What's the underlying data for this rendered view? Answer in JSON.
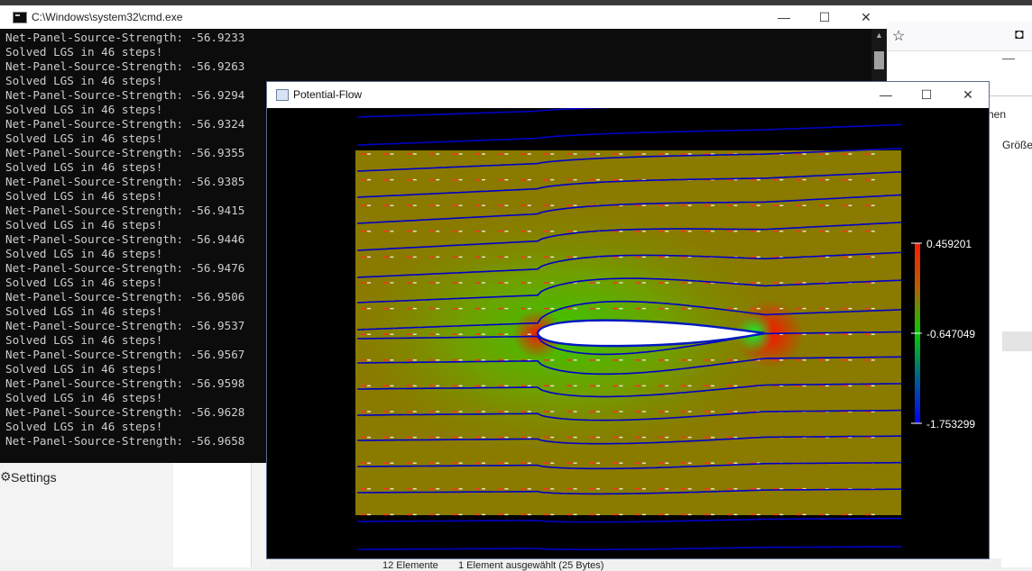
{
  "cmd": {
    "title": "C:\\Windows\\system32\\cmd.exe",
    "lines": [
      "Net-Panel-Source-Strength: -56.9233",
      "Solved LGS in 46 steps!",
      "Net-Panel-Source-Strength: -56.9263",
      "Solved LGS in 46 steps!",
      "Net-Panel-Source-Strength: -56.9294",
      "Solved LGS in 46 steps!",
      "Net-Panel-Source-Strength: -56.9324",
      "Solved LGS in 46 steps!",
      "Net-Panel-Source-Strength: -56.9355",
      "Solved LGS in 46 steps!",
      "Net-Panel-Source-Strength: -56.9385",
      "Solved LGS in 46 steps!",
      "Net-Panel-Source-Strength: -56.9415",
      "Solved LGS in 46 steps!",
      "Net-Panel-Source-Strength: -56.9446",
      "Solved LGS in 46 steps!",
      "Net-Panel-Source-Strength: -56.9476",
      "Solved LGS in 46 steps!",
      "Net-Panel-Source-Strength: -56.9506",
      "Solved LGS in 46 steps!",
      "Net-Panel-Source-Strength: -56.9537",
      "Solved LGS in 46 steps!",
      "Net-Panel-Source-Strength: -56.9567",
      "Solved LGS in 46 steps!",
      "Net-Panel-Source-Strength: -56.9598",
      "Solved LGS in 46 steps!",
      "Net-Panel-Source-Strength: -56.9628",
      "Solved LGS in 46 steps!",
      "Net-Panel-Source-Strength: -56.9658"
    ],
    "minimize_icon": "minimize-icon",
    "maximize_icon": "maximize-icon",
    "close_icon": "close-icon"
  },
  "potential_flow": {
    "title": "Potential-Flow",
    "colorbar": {
      "max_label": "0.459201",
      "mid_label": "-0.647049",
      "min_label": "-1.753299",
      "colors": [
        "#ff1a00",
        "#00cc00",
        "#0000ff"
      ]
    },
    "field_color": "#8a7a00",
    "streamline_color": "#0000c8",
    "airfoil_color": "#ffffff"
  },
  "browser": {
    "partial_text_1": "hen",
    "partial_text_2": "Größe"
  },
  "explorer": {
    "settings_label": "Settings",
    "status_items": "12 Elemente",
    "status_selected": "1 Element ausgewählt (25 Bytes)"
  }
}
